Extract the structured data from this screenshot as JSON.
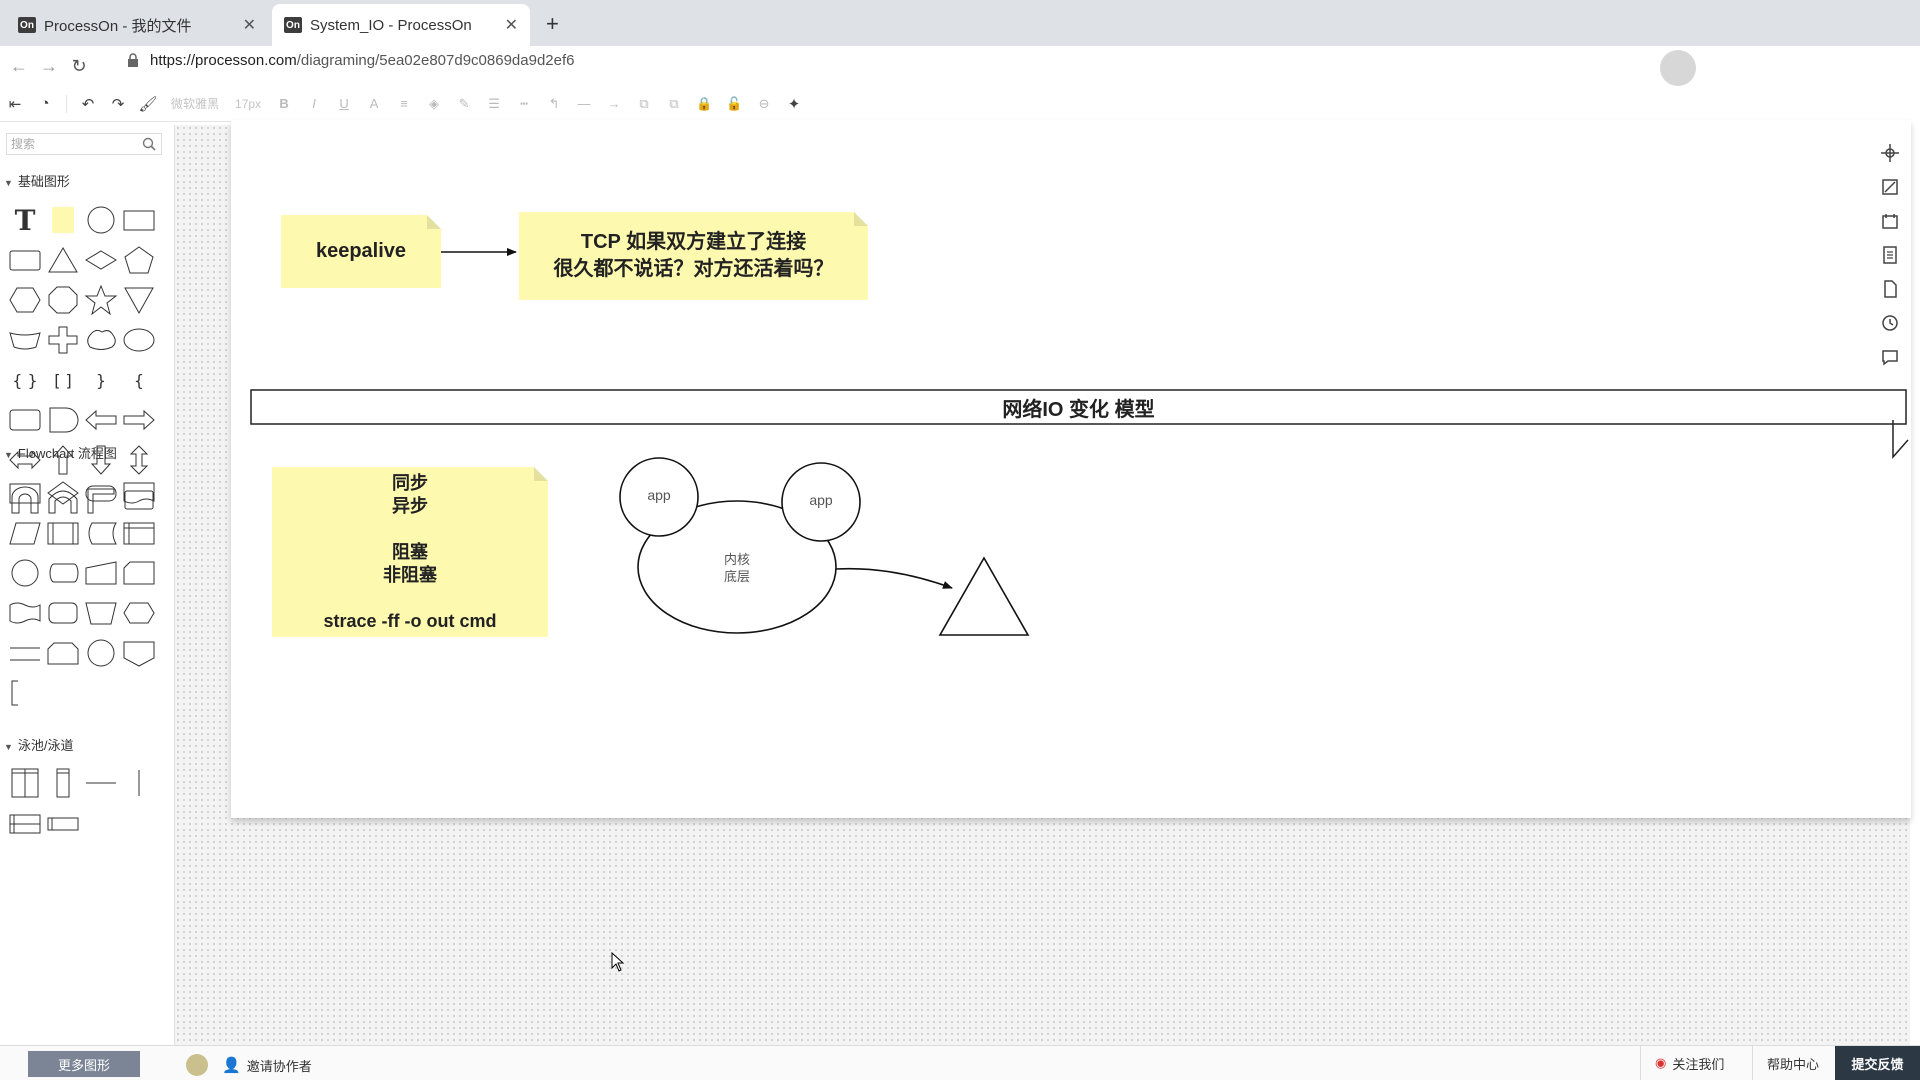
{
  "browser": {
    "tabs": [
      {
        "label": "ProcessOn - 我的文件",
        "favicon": "On"
      },
      {
        "label": "System_IO - ProcessOn",
        "favicon": "On"
      }
    ],
    "url_host": "https://processon.com",
    "url_path": "/diagraming/5ea02e807d9c0869da9d2ef6"
  },
  "toolbar": {
    "font_family": "微软雅黑",
    "font_size": "17px",
    "bold": "B",
    "italic": "I",
    "underline": "U",
    "font_color": "A"
  },
  "sidebar": {
    "search_placeholder": "搜索",
    "sections": [
      "基础图形",
      "Flowchart 流程图",
      "泳池/泳道"
    ]
  },
  "diagram": {
    "note_keepalive": "keepalive",
    "note_tcp_line1": "TCP 如果双方建立了连接",
    "note_tcp_line2": "很久都不说话？对方还活着吗？",
    "banner_title": "网络IO 变化  模型",
    "note_sync": "同步",
    "note_async": "异步",
    "note_block": "阻塞",
    "note_nonblock": "非阻塞",
    "note_strace": "strace  -ff -o out  cmd",
    "app_left": "app",
    "app_right": "app",
    "kernel_line1": "内核",
    "kernel_line2": "底层"
  },
  "bottombar": {
    "more_shapes": "更多图形",
    "invite": "邀请协作者",
    "follow": "关注我们",
    "help": "帮助中心",
    "feedback": "提交反馈"
  },
  "colors": {
    "sticky": "#fdfab0",
    "feedback_bg": "#2c3844",
    "more_shapes_bg": "#7b8596"
  }
}
